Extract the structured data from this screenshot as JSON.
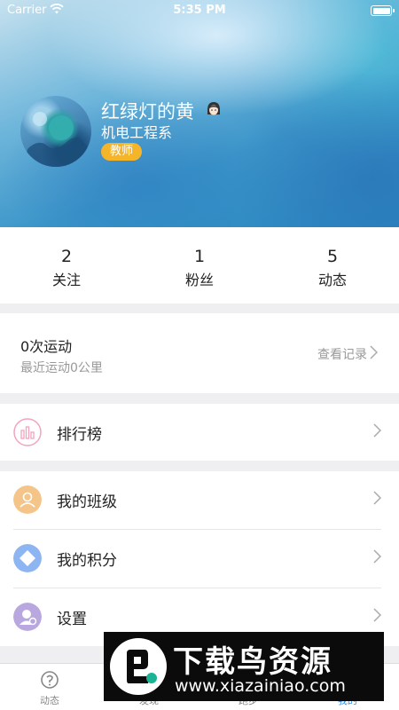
{
  "status_bar": {
    "carrier": "Carrier",
    "time": "5:35 PM"
  },
  "profile": {
    "username": "红绿灯的黄",
    "department": "机电工程系",
    "role_badge": "教师"
  },
  "stats": [
    {
      "value": "2",
      "label": "关注"
    },
    {
      "value": "1",
      "label": "粉丝"
    },
    {
      "value": "5",
      "label": "动态"
    }
  ],
  "exercise": {
    "title": "0次运动",
    "subtitle": "最近运动0公里",
    "view_records": "查看记录"
  },
  "menu": {
    "ranking": {
      "label": "排行榜",
      "icon": "bar-chart-icon",
      "color": "#f2a3bd"
    },
    "my_class": {
      "label": "我的班级",
      "icon": "person-icon",
      "color": "#f5c489"
    },
    "my_points": {
      "label": "我的积分",
      "icon": "diamond-icon",
      "color": "#8cb5f2"
    },
    "settings": {
      "label": "设置",
      "icon": "settings-avatar-icon",
      "color": "#b9a8df"
    }
  },
  "tabbar": {
    "tabs": [
      {
        "label": "动态",
        "icon": "moments-icon"
      },
      {
        "label": "发现",
        "icon": "discover-icon"
      },
      {
        "label": "跑步",
        "icon": "run-icon"
      },
      {
        "label": "我的",
        "icon": "me-icon"
      }
    ],
    "active_color": "#3a8ee6"
  },
  "watermark": {
    "title": "下载鸟资源",
    "url": "www.xiazainiao.com"
  }
}
